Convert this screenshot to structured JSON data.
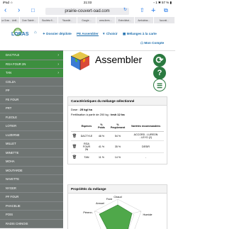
{
  "status": {
    "carrier": "iPad ☆",
    "time": "21:03",
    "battery": "▫ 1 ✱ 57 % ▮"
  },
  "browser": {
    "url": "prairie-couvert-oad.com",
    "reload": "↻",
    "back": "‹",
    "forward": "›",
    "book": "□",
    "share": "⇧",
    "new_tab": "+",
    "tabs": "⧉",
    "bookmarks": [
      "La Gran… Antil…",
      "Cran Sainté…",
      "Boulééa fi…",
      "Ricardié…",
      "Google…",
      "www.tbres…",
      "Exércitiéat…",
      "Ambuléas…",
      "Acconti…"
    ]
  },
  "header": {
    "logo_text": "LORAS",
    "home_icon": "⌂",
    "menu": [
      "✦ Dossier dépilote",
      "PE Assembler",
      "▼ Choisir",
      "▦ Mélanges à la carte"
    ],
    "account": "☖ Mon Compte"
  },
  "sidebar": {
    "items": [
      {
        "label": "DACTYLE",
        "selected": true
      },
      {
        "label": "RGA FOUR 2N",
        "selected": true
      },
      {
        "label": "TAN",
        "selected": true
      },
      {
        "label": "COLZA",
        "selected": false
      },
      {
        "label": "PP",
        "selected": false
      },
      {
        "label": "FE FOUR",
        "selected": false
      },
      {
        "label": "PRT",
        "selected": false
      },
      {
        "label": "FLEOLE",
        "selected": false
      },
      {
        "label": "LOTIER",
        "selected": false
      },
      {
        "label": "LUZERNE",
        "selected": false
      },
      {
        "label": "MILLET",
        "selected": false
      },
      {
        "label": "MINETTE",
        "selected": false
      },
      {
        "label": "MOHA",
        "selected": false
      },
      {
        "label": "MOUTARDE",
        "selected": false
      },
      {
        "label": "NAVETTE",
        "selected": false
      },
      {
        "label": "NYGER",
        "selected": false
      },
      {
        "label": "PF FOUR",
        "selected": false
      },
      {
        "label": "PHACELIE",
        "selected": false
      },
      {
        "label": "POIS",
        "selected": false
      },
      {
        "label": "RADIS CHINOIS",
        "selected": false
      }
    ]
  },
  "main": {
    "title": "Assembler",
    "refresh_icon": "⟳",
    "help_icon": "?",
    "list_icon": "☰",
    "panel1": {
      "title": "Caractéristiques du mélange sélectionné",
      "dose_label": "Dose : ",
      "dose_value": "25 kg/ ha",
      "fertilisation_label": "Fertilisation à partir de 200 kg : ",
      "fertilisation_value": "tesh 12 ha",
      "columns": [
        "",
        "Espèces",
        "%\nPoids",
        "%\nPeuplement",
        "Variétés recommandées"
      ],
      "rows": [
        {
          "species": "DACTYLE",
          "weight": "48 %",
          "pop": "54 %",
          "variety": "ACCORD - LUREON\n- LEYO (2)"
        },
        {
          "species": "RGA\nFOUR\n2N",
          "weight": "41 %",
          "pop": "35 %",
          "variety": "DESIR"
        },
        {
          "species": "TAN",
          "weight": "11 %",
          "pop": "14 %",
          "variety": "-"
        }
      ]
    },
    "panel2": {
      "title": "Propriétés du mélange",
      "axis_labels": [
        "Chaud",
        "Froid",
        "Humide",
        "Pérenn.",
        "Annuel"
      ]
    }
  },
  "colors": {
    "accent": "#1f6fae",
    "sidebar": "#6f7573",
    "selected": "#3d8f3f",
    "radar_fill": "#4fa84a"
  }
}
